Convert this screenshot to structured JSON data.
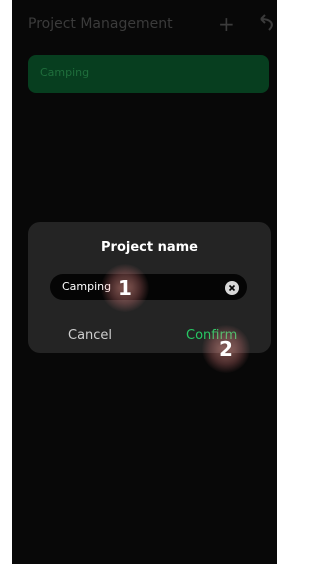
{
  "header": {
    "title": "Project Management",
    "add_icon": "plus-icon",
    "back_icon": "undo-icon"
  },
  "projects": [
    {
      "label": "Camping"
    }
  ],
  "dialog": {
    "title": "Project name",
    "input_value": "Camping",
    "clear_icon": "clear-circle-icon",
    "cancel_label": "Cancel",
    "confirm_label": "Confirm"
  },
  "annotations": {
    "step_1": "1",
    "step_2": "2"
  },
  "colors": {
    "accent_green": "#27c864",
    "card_green": "#073e1f",
    "background": "#080808",
    "dialog_bg": "#242424"
  }
}
